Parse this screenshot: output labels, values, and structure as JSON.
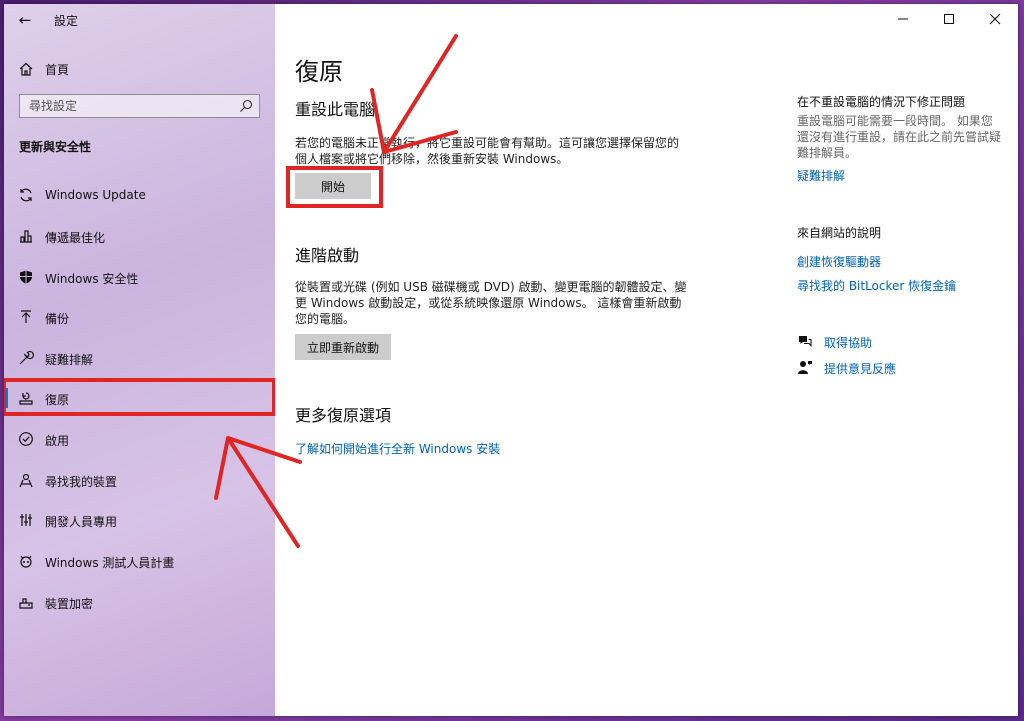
{
  "app": {
    "title": "設定",
    "back_glyph": "←"
  },
  "sidebar": {
    "home_label": "首頁",
    "search_placeholder": "尋找設定",
    "section_title": "更新與安全性",
    "items": [
      {
        "label": "Windows Update",
        "icon": "sync-icon"
      },
      {
        "label": "傳遞最佳化",
        "icon": "delivery-optimization-icon"
      },
      {
        "label": "Windows 安全性",
        "icon": "shield-icon"
      },
      {
        "label": "備份",
        "icon": "backup-arrow-icon"
      },
      {
        "label": "疑難排解",
        "icon": "wrench-icon"
      },
      {
        "label": "復原",
        "icon": "recovery-icon",
        "active": true
      },
      {
        "label": "啟用",
        "icon": "check-circle-icon"
      },
      {
        "label": "尋找我的裝置",
        "icon": "find-device-icon"
      },
      {
        "label": "開發人員專用",
        "icon": "developer-icon"
      },
      {
        "label": "Windows 測試人員計畫",
        "icon": "insider-icon"
      },
      {
        "label": "裝置加密",
        "icon": "encryption-icon"
      }
    ]
  },
  "main": {
    "page_title": "復原",
    "reset": {
      "heading": "重設此電腦",
      "desc_line1": "若您的電腦未正常執行，將它重設可能會有幫助。這可讓您選擇保留您的",
      "desc_line2": "個人檔案或將它們移除，然後重新安裝 Windows。",
      "button": "開始"
    },
    "advanced": {
      "heading": "進階啟動",
      "desc_line1": "從裝置或光碟 (例如 USB 磁碟機或 DVD) 啟動、變更電腦的韌體設定、變",
      "desc_line2": "更 Windows 啟動設定，或從系統映像還原 Windows。 這樣會重新啟動",
      "desc_line3": "您的電腦。",
      "button": "立即重新啟動"
    },
    "more": {
      "heading": "更多復原選項",
      "link": "了解如何開始進行全新 Windows 安裝"
    }
  },
  "side_panel": {
    "fix_title": "在不重設電腦的情況下修正問題",
    "fix_text_line1": "重設電腦可能需要一段時間。 如果您",
    "fix_text_line2": "還沒有進行重設，請在此之前先嘗試疑",
    "fix_text_line3": "難排解員。",
    "fix_link": "疑難排解",
    "web_title": "來自網站的說明",
    "web_link1": "創建恢復驅動器",
    "web_link2": "尋找我的 BitLocker 恢復金鑰",
    "help_link": "取得協助",
    "feedback_link": "提供意見反應"
  },
  "colors": {
    "accent": "#0078d7",
    "link": "#0063b1",
    "annotation": "#e02525"
  }
}
